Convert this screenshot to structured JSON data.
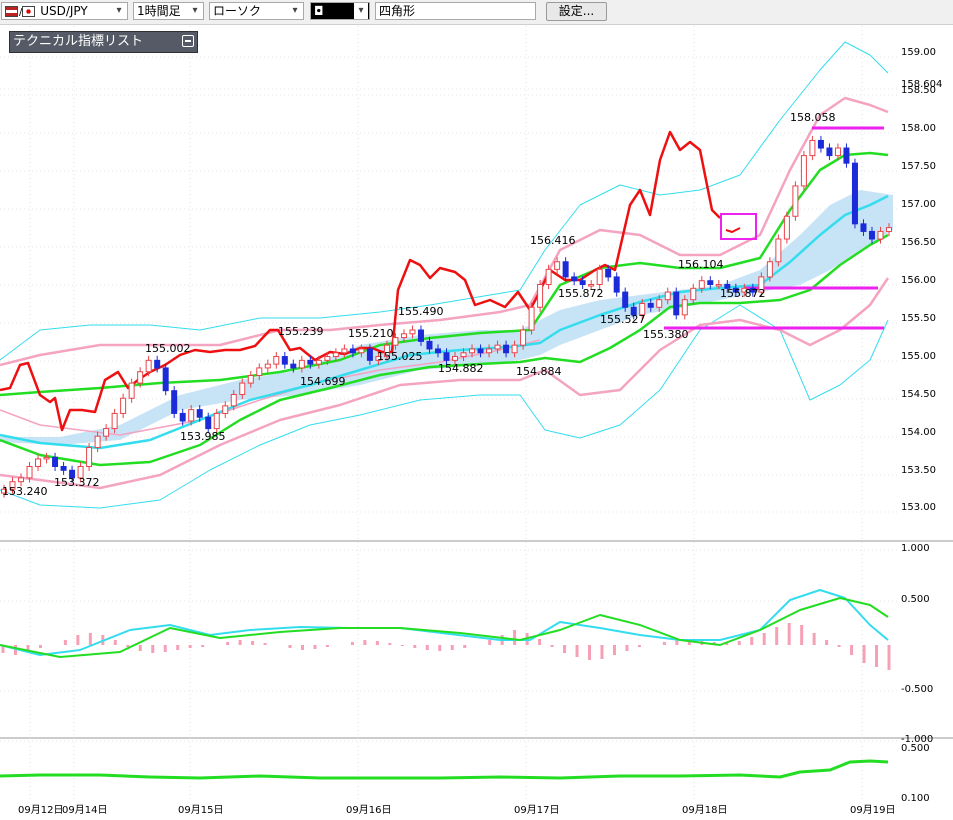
{
  "toolbar": {
    "symbol": "USD/JPY",
    "timeframe": "1時間足",
    "chart_type": "ローソク",
    "drawing_color": "◘",
    "drawing_tool": "四角形",
    "settings_button": "設定..."
  },
  "indicator_panel": {
    "title": "テクニカル指標リスト"
  },
  "price_axis": [
    "159.00",
    "158.604",
    "158.50",
    "158.00",
    "157.50",
    "157.00",
    "156.50",
    "156.00",
    "155.50",
    "155.00",
    "154.50",
    "154.00",
    "153.50",
    "153.00"
  ],
  "macd_axis": [
    "1.000",
    "0.500",
    "-0.500",
    "-1.000"
  ],
  "rci_axis": [
    "0.500",
    "0.100"
  ],
  "time_axis": [
    "09月12日",
    "09月14日",
    "09月15日",
    "09月16日",
    "09月17日",
    "09月18日",
    "09月19日"
  ],
  "annotations": [
    "153.240",
    "153.372",
    "155.002",
    "153.985",
    "155.239",
    "154.699",
    "155.210",
    "155.025",
    "155.490",
    "154.882",
    "154.884",
    "156.416",
    "155.872",
    "155.527",
    "155.380",
    "156.104",
    "155.872",
    "158.058"
  ],
  "colors": {
    "bull": "#e8434a",
    "bear": "#1c2bd8",
    "cloud": "#b9dcf4",
    "red_line": "#ee1010",
    "cyan": "#33ddee",
    "green": "#22dd22",
    "pink": "#f4a3c0",
    "magenta": "#ee22ee"
  },
  "chart_data": {
    "type": "candlestick",
    "y_range": [
      152.8,
      159.4
    ],
    "closes": [
      153.3,
      153.4,
      153.45,
      153.6,
      153.7,
      153.72,
      153.6,
      153.55,
      153.45,
      153.6,
      153.85,
      154.0,
      154.1,
      154.3,
      154.5,
      154.7,
      154.85,
      155.0,
      154.9,
      154.6,
      154.3,
      154.2,
      154.35,
      154.25,
      154.1,
      154.3,
      154.4,
      154.55,
      154.7,
      154.8,
      154.9,
      154.95,
      155.05,
      154.95,
      154.9,
      155.0,
      154.95,
      155.0,
      155.05,
      155.1,
      155.15,
      155.1,
      155.15,
      155.0,
      155.05,
      155.2,
      155.3,
      155.35,
      155.4,
      155.25,
      155.15,
      155.1,
      155.0,
      155.05,
      155.1,
      155.15,
      155.1,
      155.15,
      155.2,
      155.1,
      155.2,
      155.4,
      155.7,
      156.0,
      156.2,
      156.3,
      156.1,
      156.05,
      156.0,
      156.0,
      156.2,
      156.1,
      155.9,
      155.7,
      155.6,
      155.75,
      155.7,
      155.8,
      155.9,
      155.6,
      155.8,
      155.95,
      156.05,
      156.0,
      156.0,
      155.95,
      155.9,
      155.95,
      155.9,
      156.1,
      156.3,
      156.6,
      156.9,
      157.3,
      157.7,
      157.9,
      157.8,
      157.7,
      157.8,
      157.6,
      156.8,
      156.7,
      156.6,
      156.7,
      156.75
    ]
  }
}
